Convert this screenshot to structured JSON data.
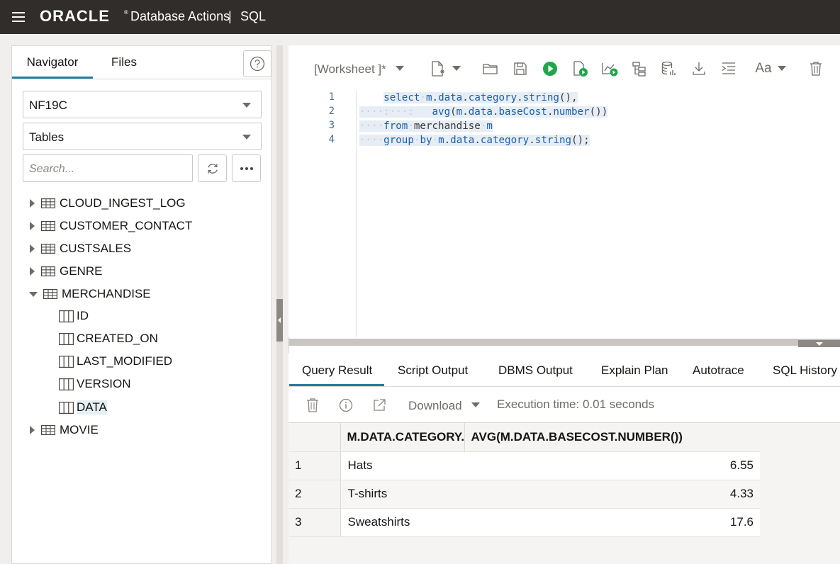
{
  "header": {
    "brand": "ORACLE",
    "brand_reg": "®",
    "app_title": "Database Actions",
    "separator": "|",
    "page": "SQL"
  },
  "navigator": {
    "tabs": [
      "Navigator",
      "Files"
    ],
    "schema": "NF19C",
    "object_type": "Tables",
    "search_placeholder": "Search...",
    "tree": [
      {
        "label": "CLOUD_INGEST_LOG",
        "type": "table",
        "expanded": false
      },
      {
        "label": "CUSTOMER_CONTACT",
        "type": "table",
        "expanded": false
      },
      {
        "label": "CUSTSALES",
        "type": "table",
        "expanded": false
      },
      {
        "label": "GENRE",
        "type": "table",
        "expanded": false
      },
      {
        "label": "MERCHANDISE",
        "type": "table",
        "expanded": true
      },
      {
        "label": "ID",
        "type": "column"
      },
      {
        "label": "CREATED_ON",
        "type": "column"
      },
      {
        "label": "LAST_MODIFIED",
        "type": "column"
      },
      {
        "label": "VERSION",
        "type": "column"
      },
      {
        "label": "DATA",
        "type": "column",
        "selected": true
      },
      {
        "label": "MOVIE",
        "type": "table",
        "expanded": false
      }
    ]
  },
  "worksheet": {
    "name": "[Worksheet ]*",
    "font_label": "Aa",
    "lines": [
      "1",
      "2",
      "3",
      "4"
    ]
  },
  "results": {
    "tabs": [
      "Query Result",
      "Script Output",
      "DBMS Output",
      "Explain Plan",
      "Autotrace",
      "SQL History"
    ],
    "download_label": "Download",
    "execution_time": "Execution time: 0.01 seconds",
    "columns": [
      "M.DATA.CATEGORY.STRING()",
      "AVG(M.DATA.BASECOST.NUMBER())"
    ],
    "rows": [
      {
        "n": "1",
        "category": "Hats",
        "avg": "6.55"
      },
      {
        "n": "2",
        "category": "T-shirts",
        "avg": "4.33"
      },
      {
        "n": "3",
        "category": "Sweatshirts",
        "avg": "17.6"
      }
    ]
  },
  "colors": {
    "header_bg": "#312d2a",
    "accent": "#227e9e",
    "run_green": "#1fa64a",
    "sql_keyword": "#1c5fa8"
  }
}
